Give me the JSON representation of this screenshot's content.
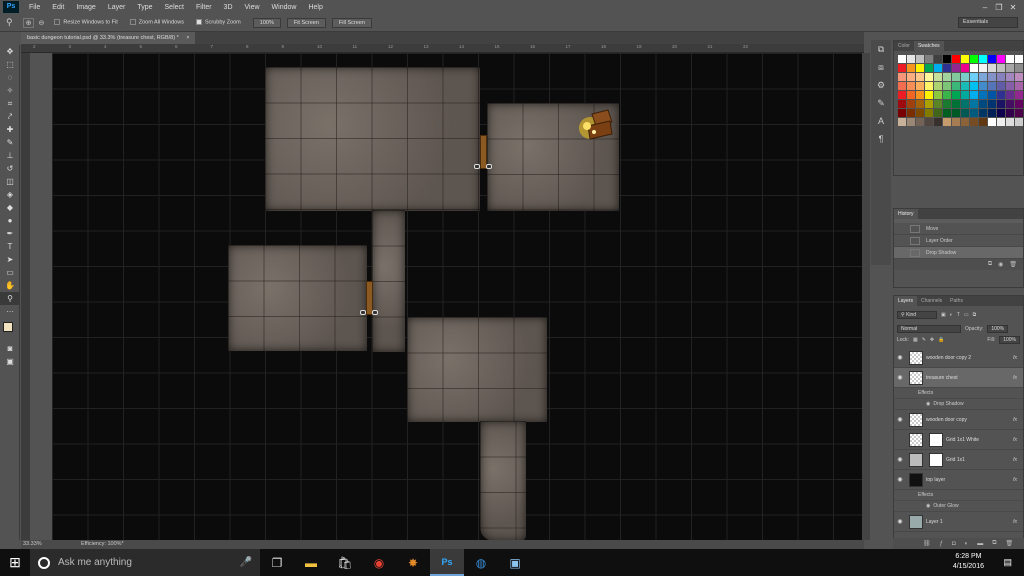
{
  "app": {
    "logo": "Ps"
  },
  "menu": [
    "File",
    "Edit",
    "Image",
    "Layer",
    "Type",
    "Select",
    "Filter",
    "3D",
    "View",
    "Window",
    "Help"
  ],
  "window_controls": {
    "minimize": "–",
    "restore": "❐",
    "close": "✕"
  },
  "options": {
    "resize_windows": "Resize Windows to Fit",
    "zoom_all": "Zoom All Windows",
    "scrubby_zoom": "Scrubby Zoom",
    "btn_100": "100%",
    "btn_fit": "Fit Screen",
    "btn_fill": "Fill Screen",
    "workspace": "Essentials"
  },
  "document": {
    "tab_title": "basic dungeon tutorial.psd @ 33.3% (treasure chest, RGB/8) *",
    "close": "×"
  },
  "ruler_ticks": [
    "2",
    "3",
    "4",
    "5",
    "6",
    "7",
    "8",
    "9",
    "10",
    "11",
    "12",
    "13",
    "14",
    "15",
    "16",
    "17",
    "18",
    "19",
    "20",
    "21",
    "22"
  ],
  "status": {
    "zoom": "33.33%",
    "info": "Efficiency: 100%*"
  },
  "color_panel": {
    "tabs": [
      "Color",
      "Swatches"
    ],
    "active": "Swatches"
  },
  "swatch_colors": [
    "#ffffff",
    "#e6e6e6",
    "#c0c0c0",
    "#7f7f7f",
    "#404040",
    "#000000",
    "#ff0000",
    "#ffff00",
    "#00ff00",
    "#00ffff",
    "#0000ff",
    "#ff00ff",
    "#ffffff",
    "#ffffff",
    "#ed1c24",
    "#f7941d",
    "#fff200",
    "#00a651",
    "#00aeef",
    "#2e3192",
    "#92278f",
    "#ec008c",
    "#ffffff",
    "#f2f2f2",
    "#d9d9d9",
    "#bfbfbf",
    "#a6a6a6",
    "#8c8c8c",
    "#f69679",
    "#f9ad81",
    "#fdc68a",
    "#fff79a",
    "#c4df9b",
    "#a3d39c",
    "#82ca9d",
    "#7bcdc8",
    "#6dcff6",
    "#7da7d9",
    "#8393ca",
    "#8781bd",
    "#a187be",
    "#bd8cbf",
    "#f26c4f",
    "#f68e55",
    "#fbaf5d",
    "#fff467",
    "#acd372",
    "#7cc576",
    "#3bb878",
    "#1abbb4",
    "#00bff3",
    "#438ccb",
    "#5574b9",
    "#605ca8",
    "#855fa8",
    "#a763a8",
    "#ed1c24",
    "#f26522",
    "#f7941d",
    "#fff200",
    "#8dc63f",
    "#39b54a",
    "#00a651",
    "#00a99d",
    "#00aeef",
    "#0072bc",
    "#0054a6",
    "#2e3192",
    "#662d91",
    "#92278f",
    "#9e0b0f",
    "#a0410d",
    "#a3620a",
    "#aba000",
    "#598527",
    "#197b30",
    "#007236",
    "#00746b",
    "#0076a3",
    "#004a80",
    "#003471",
    "#1b1464",
    "#440e62",
    "#630460",
    "#790000",
    "#7b2e00",
    "#7d4900",
    "#827b00",
    "#406618",
    "#005e20",
    "#005826",
    "#005952",
    "#005b7f",
    "#003663",
    "#002157",
    "#0d004c",
    "#32004b",
    "#4b0049",
    "#c7b299",
    "#998675",
    "#736357",
    "#534741",
    "#37302d",
    "#c69c6d",
    "#a67c52",
    "#8c6239",
    "#754c24",
    "#603913",
    "#ffffff",
    "#eeeeee",
    "#dddddd",
    "#cccccc"
  ],
  "history": {
    "tabs": [
      "History"
    ],
    "items": [
      "Move",
      "Layer Order",
      "Drop Shadow"
    ],
    "selected": "Drop Shadow"
  },
  "layers_panel": {
    "tabs": [
      "Layers",
      "Channels",
      "Paths"
    ],
    "kind": "Kind",
    "blend": "Normal",
    "opacity_label": "Opacity:",
    "opacity": "100%",
    "lock_label": "Lock:",
    "fill_label": "Fill:",
    "fill": "100%",
    "layers": [
      {
        "name": "wooden door copy 2",
        "fx": "fx"
      },
      {
        "name": "treasure chest",
        "fx": "fx",
        "effects": "Effects",
        "effect": "Drop Shadow"
      },
      {
        "name": "wooden door copy",
        "fx": "fx"
      },
      {
        "name": "Grid 1x1 White",
        "fx": "fx"
      },
      {
        "name": "Grid 1x1",
        "fx": "fx"
      },
      {
        "name": "top layer",
        "fx": "fx",
        "effects": "Effects",
        "effect": "Outer Glow"
      },
      {
        "name": "Layer 1",
        "fx": "fx"
      }
    ]
  },
  "taskbar": {
    "search_placeholder": "Ask me anything",
    "time": "6:28 PM",
    "date": "4/15/2016"
  }
}
